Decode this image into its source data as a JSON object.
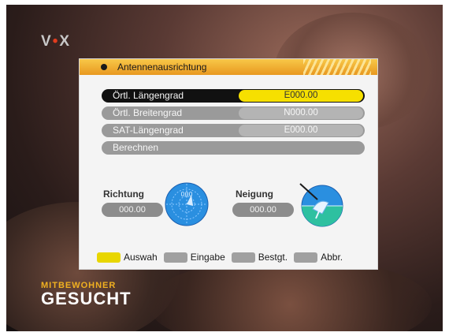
{
  "channel_logo": {
    "text_left": "V",
    "text_mid": "•",
    "text_right": "X"
  },
  "show_banner": {
    "line1": "MITBEWOHNER",
    "line2": "GESUCHT"
  },
  "menu": {
    "title": "Antennenausrichtung",
    "items": [
      {
        "label": "Örtl. Längengrad",
        "value": "E000.00",
        "selected": true
      },
      {
        "label": "Örtl. Breitengrad",
        "value": "N000.00",
        "selected": false
      },
      {
        "label": "SAT-Längengrad",
        "value": "E000.00",
        "selected": false
      },
      {
        "label": "Berechnen",
        "value": "",
        "selected": false
      }
    ],
    "direction": {
      "label": "Richtung",
      "value": "000.00",
      "compass_text": "000"
    },
    "tilt": {
      "label": "Neigung",
      "value": "000.00"
    },
    "footer": [
      {
        "key": "yellow-key",
        "label": "Auswah"
      },
      {
        "key": "ok-key",
        "label": "Eingabe"
      },
      {
        "key": "green-key",
        "label": "Bestgt."
      },
      {
        "key": "menu-key",
        "label": "Abbr."
      }
    ]
  },
  "colors": {
    "header": "#f0b030",
    "selected_value": "#f6e000",
    "row_bg": "#9a9a9a",
    "compass": "#2a8fe0"
  }
}
